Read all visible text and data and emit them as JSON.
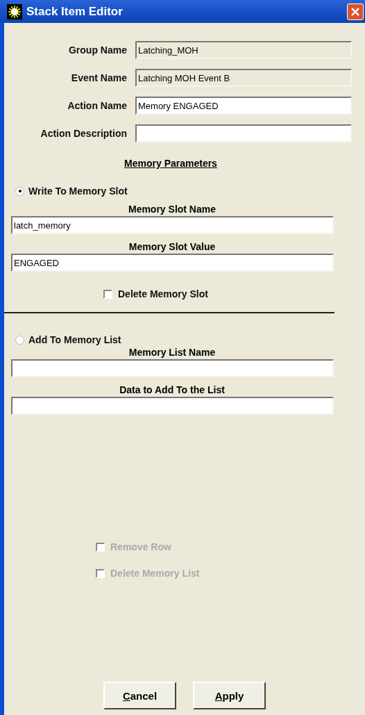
{
  "window": {
    "title": "Stack Item Editor"
  },
  "fields": [
    {
      "label": "Group Name",
      "value": "Latching_MOH",
      "disabled": true
    },
    {
      "label": "Event Name",
      "value": "Latching MOH Event B",
      "disabled": true
    },
    {
      "label": "Action Name",
      "value": "Memory ENGAGED",
      "disabled": false
    },
    {
      "label": "Action Description",
      "disabled": false
    }
  ],
  "section_title": "Memory Parameters",
  "slot": {
    "option": {
      "label": "Write To Memory Slot",
      "selected": true
    },
    "name_label": "Memory Slot Name",
    "name_value": "latch_memory",
    "value_label": "Memory Slot Value",
    "value_value": "ENGAGED",
    "delete": {
      "label": "Delete Memory Slot",
      "checked": false,
      "disabled": false
    }
  },
  "list": {
    "option": {
      "label": "Add To Memory List",
      "selected": false
    },
    "name_label": "Memory List Name",
    "data_label": "Data to Add To the List"
  },
  "list_checks": [
    {
      "label": "Remove Row",
      "checked": false,
      "disabled": true
    },
    {
      "label": "Delete Memory List",
      "checked": false,
      "disabled": true
    }
  ],
  "buttons": [
    "Cancel",
    "Apply"
  ]
}
